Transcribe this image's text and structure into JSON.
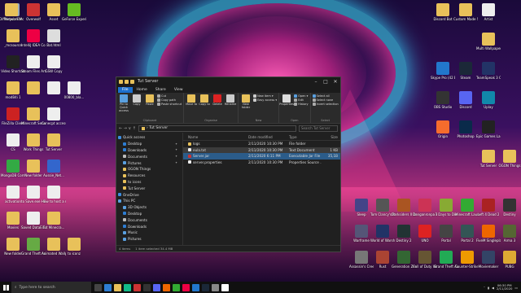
{
  "desktop_left": [
    {
      "label": "Recycle Bin",
      "color": "#9ab"
    },
    {
      "label": "Overwolf",
      "color": "#c33"
    },
    {
      "label": "Asset",
      "color": "#e8c15a"
    },
    {
      "label": "GeForce Experience",
      "color": "#6b2"
    },
    {
      "label": "DiffNetwork Mods Lo...",
      "color": "#e8c15a"
    },
    {
      "label": "_mcsource",
      "color": "#e8c15a"
    },
    {
      "label": "IntelliJ IDEA Communi...",
      "color": "#e04"
    },
    {
      "label": "Bat.html",
      "color": "#ddd"
    },
    {
      "label": "Video Shortcut",
      "color": "#222"
    },
    {
      "label": "Steam Files Art",
      "color": "#eee"
    },
    {
      "label": "GSW Copy",
      "color": "#eee"
    },
    {
      "label": "modB4i 1",
      "color": "#e8c15a"
    },
    {
      "label": "",
      "color": "#e8c15a"
    },
    {
      "label": "",
      "color": "#eee"
    },
    {
      "label": "00800_bla...",
      "color": "#eee"
    },
    {
      "label": "FileZilla Client",
      "color": "#c22"
    },
    {
      "label": "Minecraft Server",
      "color": "#e8c15a"
    },
    {
      "label": "Conecpt access.txt",
      "color": "#eee"
    },
    {
      "label": "CS",
      "color": "#eee"
    },
    {
      "label": "Work Things",
      "color": "#e8c15a"
    },
    {
      "label": "Tut Server",
      "color": "#e8c15a"
    },
    {
      "label": "MongoDB Compass",
      "color": "#3a4"
    },
    {
      "label": "New folder",
      "color": "#e8c15a"
    },
    {
      "label": "Aussie_Net...",
      "color": "#36c"
    },
    {
      "label": "activation",
      "color": "#eee"
    },
    {
      "label": "to Save.exe - Shortcut",
      "color": "#eee"
    },
    {
      "label": "How to host a minecraft...",
      "color": "#eee"
    },
    {
      "label": "Movies",
      "color": "#e8c15a"
    },
    {
      "label": "Saved DataEdit",
      "color": "#eee"
    },
    {
      "label": "Tut Minecra...",
      "color": "#e8c15a"
    },
    {
      "label": "New folder",
      "color": "#e8c15a"
    },
    {
      "label": "Grand Theft Auto V - Fath",
      "color": "#6a4"
    },
    {
      "label": "Animated Wallpapers",
      "color": "#e8c15a"
    },
    {
      "label": "to iconz",
      "color": "#e8c15a"
    }
  ],
  "desktop_right": [
    {
      "label": "Discord Bot",
      "color": "#e8c15a"
    },
    {
      "label": "Custom Made Scripts",
      "color": "#e8c15a"
    },
    {
      "label": "Artist",
      "color": "#eee"
    },
    {
      "label": "Multi Wallpapers",
      "color": "#e8c15a"
    },
    {
      "label": "Skype Pro (42 Bit Bit)",
      "color": "#27c"
    },
    {
      "label": "Steam",
      "color": "#1b2838"
    },
    {
      "label": "TeamSpeak 3 Client",
      "color": "#236"
    },
    {
      "label": "OBS Studio",
      "color": "#333"
    },
    {
      "label": "Discord",
      "color": "#5865f2"
    },
    {
      "label": "Uplay",
      "color": "#18a"
    },
    {
      "label": "Origin",
      "color": "#f56c2d"
    },
    {
      "label": "Photoshop",
      "color": "#0a2a4a"
    },
    {
      "label": "Epic Games Launcher",
      "color": "#222"
    },
    {
      "label": "Tut Server",
      "color": "#e8c15a"
    },
    {
      "label": "OGON Things",
      "color": "#e8c15a"
    }
  ],
  "games": [
    {
      "label": "Sleep",
      "color": "#448"
    },
    {
      "label": "Tom Clancy's Rainbow Six...",
      "color": "#555"
    },
    {
      "label": "Darksiders II Deathinit...",
      "color": "#a52"
    },
    {
      "label": "Danganronpa Wakanter...",
      "color": "#c35"
    },
    {
      "label": "7 Days to Die",
      "color": "#8a3"
    },
    {
      "label": "Minecraft Launcher",
      "color": "#3a3"
    },
    {
      "label": "Left 4 Dead 2",
      "color": "#a22"
    },
    {
      "label": "Destiny",
      "color": "#333"
    },
    {
      "label": "Warframe",
      "color": "#557"
    },
    {
      "label": "World of Warships",
      "color": "#236"
    },
    {
      "label": "Destiny 2",
      "color": "#233"
    },
    {
      "label": "UNO",
      "color": "#d22"
    },
    {
      "label": "Portal",
      "color": "#444"
    },
    {
      "label": "Portal 2",
      "color": "#355"
    },
    {
      "label": "FiveM Singleplayer",
      "color": "#e60"
    },
    {
      "label": "Arma 3",
      "color": "#563"
    },
    {
      "label": "Assassin's Creed Unity",
      "color": "#777"
    },
    {
      "label": "Rust",
      "color": "#a43"
    },
    {
      "label": "Generation Zero",
      "color": "#363"
    },
    {
      "label": "Call of Duty World at War",
      "color": "#653"
    },
    {
      "label": "Grand Theft Auto V",
      "color": "#2a5"
    },
    {
      "label": "Counter-Strike Global Offe...",
      "color": "#e90"
    },
    {
      "label": "Moviemaker",
      "color": "#346"
    },
    {
      "label": "PUBG",
      "color": "#da3"
    }
  ],
  "explorer": {
    "title": "Tut Server",
    "tabs": [
      "File",
      "Home",
      "Share",
      "View"
    ],
    "ribbon": {
      "clipboard": {
        "name": "Clipboard",
        "pin": "Pin to Quick access",
        "copy": "Copy",
        "paste": "Paste",
        "cut": "Cut",
        "copy_path": "Copy path",
        "paste_shortcut": "Paste shortcut"
      },
      "organise": {
        "name": "Organise",
        "move": "Move to",
        "copy": "Copy to",
        "delete": "Delete",
        "rename": "Rename"
      },
      "new": {
        "name": "New",
        "folder": "New folder",
        "item": "New item ▾",
        "easy": "Easy access ▾"
      },
      "open": {
        "name": "Open",
        "properties": "Properties",
        "open": "Open ▾",
        "edit": "Edit",
        "history": "History"
      },
      "select": {
        "name": "Select",
        "all": "Select all",
        "none": "Select none",
        "invert": "Invert selection"
      }
    },
    "address": {
      "nav": "←  →  ∨  ↑",
      "path": "›  Tut Server",
      "search": "Search Tut Server"
    },
    "nav_items": [
      {
        "label": "Quick access",
        "color": "#3b8de0",
        "pin": ""
      },
      {
        "label": "Desktop",
        "color": "#2d7dd2",
        "pin": "✦"
      },
      {
        "label": "Downloads",
        "color": "#2d7dd2",
        "pin": "✦"
      },
      {
        "label": "Documents",
        "color": "#bbb",
        "pin": "✦"
      },
      {
        "label": "Pictures",
        "color": "#5aa0e0",
        "pin": "✦"
      },
      {
        "label": "OGON Things",
        "color": "#e8c15a",
        "pin": ""
      },
      {
        "label": "Resources",
        "color": "#e8c15a",
        "pin": ""
      },
      {
        "label": "to icons",
        "color": "#e8c15a",
        "pin": ""
      },
      {
        "label": "Tut Server",
        "color": "#e8c15a",
        "pin": ""
      },
      {
        "label": "OneDrive",
        "color": "#3b8de0",
        "pin": ""
      },
      {
        "label": "This PC",
        "color": "#5aa0e0",
        "pin": ""
      },
      {
        "label": "3D Objects",
        "color": "#5aa0e0",
        "pin": ""
      },
      {
        "label": "Desktop",
        "color": "#2d7dd2",
        "pin": ""
      },
      {
        "label": "Documents",
        "color": "#bbb",
        "pin": ""
      },
      {
        "label": "Downloads",
        "color": "#2d7dd2",
        "pin": ""
      },
      {
        "label": "Music",
        "color": "#5aa0e0",
        "pin": ""
      },
      {
        "label": "Pictures",
        "color": "#5aa0e0",
        "pin": ""
      }
    ],
    "columns": {
      "name": "Name",
      "date": "Date modified",
      "type": "Type",
      "size": "Size"
    },
    "files": [
      {
        "name": "logs",
        "date": "2/11/2020 10:30 PM",
        "type": "File folder",
        "size": "",
        "color": "#e8c15a",
        "state": ""
      },
      {
        "name": "eula.txt",
        "date": "2/11/2020 10:30 PM",
        "type": "Text Document",
        "size": "1 KB",
        "color": "#eee",
        "state": "hov"
      },
      {
        "name": "Server.jar",
        "date": "2/11/2020 6:11 PM",
        "type": "Executable Jar File",
        "size": "35,1B",
        "color": "#c33",
        "state": "sel"
      },
      {
        "name": "server.properties",
        "date": "2/11/2020 10:30 PM",
        "type": "Properties Source ...",
        "size": "",
        "color": "#eee",
        "state": ""
      }
    ],
    "status": {
      "count": "4 items",
      "selected": "1 item selected  34.4 MB"
    }
  },
  "taskbar": {
    "search": "Type here to search",
    "apps": [
      "#444",
      "#2d7dd2",
      "#e8c15a",
      "#1b8",
      "#c33",
      "#333",
      "#5865f2",
      "#e60",
      "#3a3",
      "#e04",
      "#27c",
      "#1b2838",
      "#888",
      "#fff"
    ],
    "time": "06:30 PM",
    "date": "2/11/2020"
  }
}
